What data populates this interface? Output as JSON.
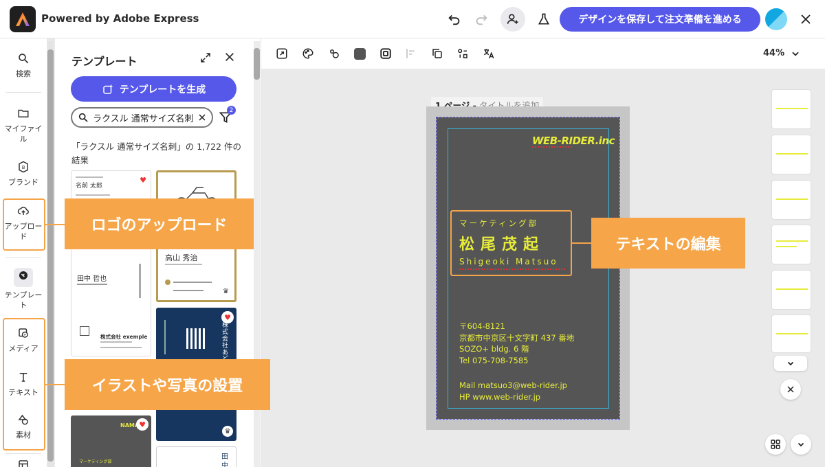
{
  "header": {
    "app_title": "Powered by Adobe Express",
    "save_label": "デザインを保存して注文準備を進める"
  },
  "rail": {
    "search": "検索",
    "my_files": "マイファイル",
    "brand": "ブランド",
    "upload": "アップロード",
    "templates": "テンプレート",
    "media": "メディア",
    "text": "テキスト",
    "elements": "素材"
  },
  "panel": {
    "title": "テンプレート",
    "generate_label": "テンプレートを生成",
    "search_value": "ラクスル 通常サイズ名刺",
    "filter_count": "2",
    "result_text": "「ラクスル 通常サイズ名刺」の 1,722 件の結果",
    "thumbs": {
      "t1_name": "名前 太郎",
      "t2_name": "高山 秀治",
      "t3_name": "田中 哲也",
      "t3_company": "株式会社 exemple",
      "t4_side": "株式会社あどび",
      "t5_brand": "NAMAE",
      "t5_dept": "マーケティング部",
      "t6_name": "田中"
    }
  },
  "canvas": {
    "zoom": "44%",
    "page_number": "1 ページ -",
    "page_title_placeholder": "タイトルを追加"
  },
  "card": {
    "brand": "WEB-RIDER.inc",
    "dept": "マーケティング部",
    "name_jp": "松尾茂起",
    "name_en": "Shigeoki Matsuo",
    "address": [
      "〒604-8121",
      "京都市中京区十文字町 437 番地",
      "SOZO+ bldg. 6 階",
      "Tel 075-708-7585"
    ],
    "contact": [
      "Mail matsuo3@web-rider.jp",
      "HP www.web-rider.jp"
    ]
  },
  "annotations": {
    "logo_upload": "ロゴのアップロード",
    "text_edit": "テキストの編集",
    "illustration": "イラストや写真の設置"
  },
  "colors": {
    "accent": "#5558e8",
    "callout": "#f6a548",
    "card_bg": "#555555",
    "card_text": "#e7ec3a"
  }
}
